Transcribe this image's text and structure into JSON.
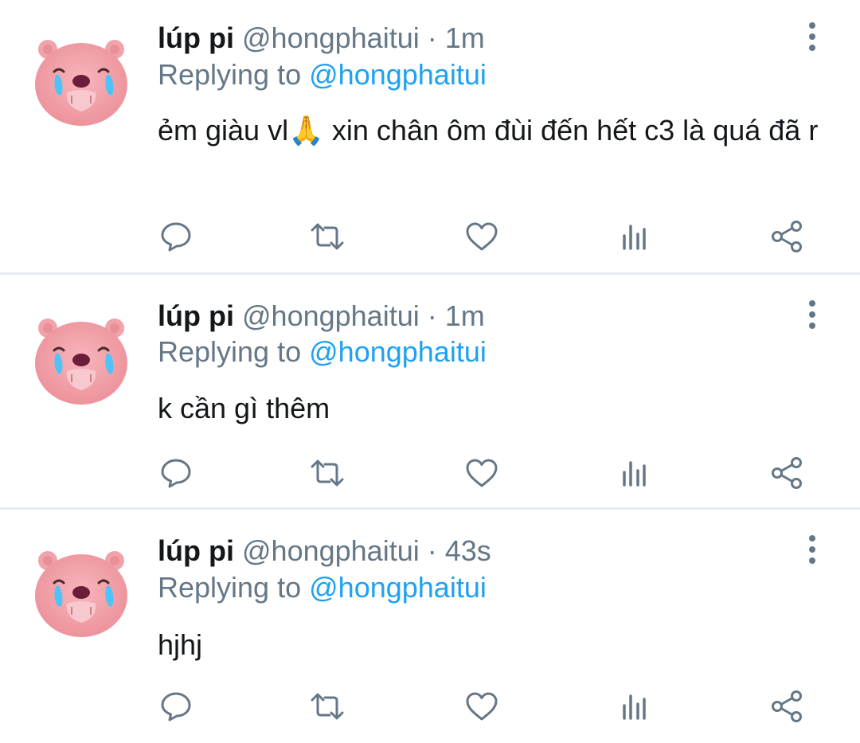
{
  "tweets": [
    {
      "name": "lúp pi",
      "handle": "@hongphaitui",
      "separator": "·",
      "time": "1m",
      "replying_prefix": "Replying to",
      "replying_to": "@hongphaitui",
      "text": "ẻm giàu vl🙏 xin chân ôm đùi đến hết c3 là quá đã r"
    },
    {
      "name": "lúp pi",
      "handle": "@hongphaitui",
      "separator": "·",
      "time": "1m",
      "replying_prefix": "Replying to",
      "replying_to": "@hongphaitui",
      "text": "k cần gì thêm"
    },
    {
      "name": "lúp pi",
      "handle": "@hongphaitui",
      "separator": "·",
      "time": "43s",
      "replying_prefix": "Replying to",
      "replying_to": "@hongphaitui",
      "text": "hjhj"
    }
  ],
  "icons": {
    "reply": "reply-icon",
    "retweet": "retweet-icon",
    "like": "heart-icon",
    "analytics": "analytics-icon",
    "share": "share-icon",
    "more": "more-vertical-icon",
    "avatar": "pink-bear-crying-avatar"
  },
  "colors": {
    "text": "#14171a",
    "secondary": "#657786",
    "link": "#1da1f2",
    "divider": "#e6ecf0",
    "avatar_pink": "#f4a7ae"
  }
}
